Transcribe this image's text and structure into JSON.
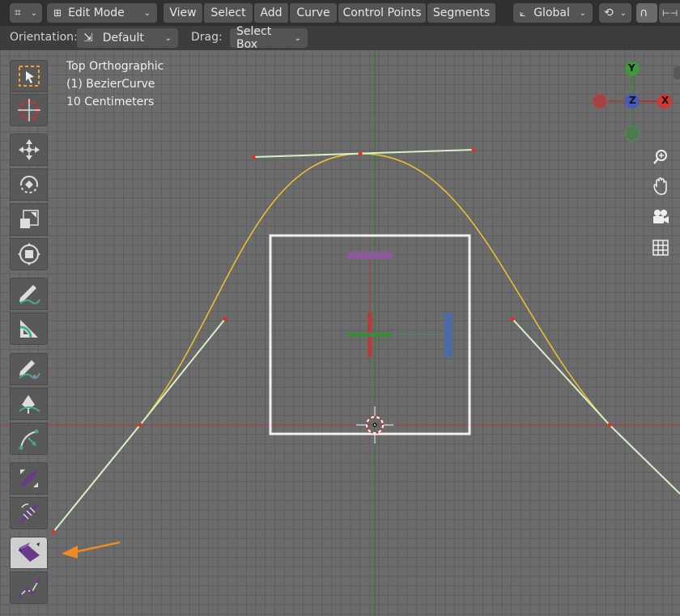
{
  "header": {
    "mode_label": "Edit Mode",
    "menus": [
      "View",
      "Select",
      "Add",
      "Curve",
      "Control Points",
      "Segments"
    ],
    "transform_orientation": "Global"
  },
  "tool_settings": {
    "orientation_label": "Orientation:",
    "orientation_value": "Default",
    "drag_label": "Drag:",
    "drag_value": "Select Box"
  },
  "viewport_info": {
    "line1": "Top Orthographic",
    "line2": "(1) BezierCurve",
    "line3": "10 Centimeters"
  },
  "gizmo": {
    "y": "Y",
    "z": "Z",
    "x": "X"
  },
  "toolbar": {
    "tools": [
      "select-box",
      "cursor",
      "move",
      "rotate",
      "scale",
      "transform",
      "annotate",
      "measure",
      "draw",
      "pen",
      "curve-tool",
      "radius",
      "tilt",
      "extrude",
      "randomize"
    ],
    "active_tool": "extrude"
  },
  "colors": {
    "accent_handle": "#d8f0c8",
    "curve": "#e8c030",
    "control_point": "#e03020",
    "arrow": "#f08a24",
    "x_axis": "#a83a3a",
    "y_axis": "#2e7a2e"
  }
}
